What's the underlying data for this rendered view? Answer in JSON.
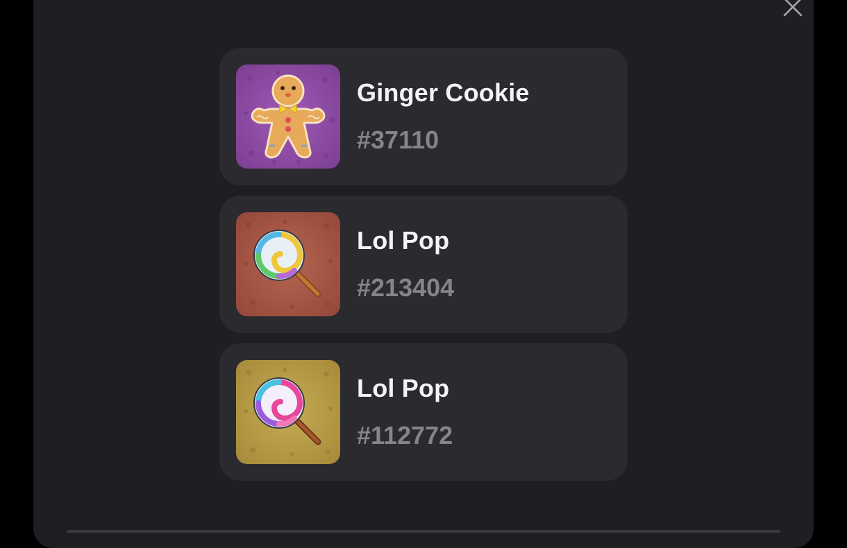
{
  "modal": {
    "close_icon": "close-icon",
    "items": [
      {
        "name": "Ginger Cookie",
        "id": "#37110",
        "icon": "gingerbread-cookie-icon",
        "bg_color": "#8e4aa5"
      },
      {
        "name": "Lol Pop",
        "id": "#213404",
        "icon": "lollipop-icon",
        "bg_color": "#a4533f"
      },
      {
        "name": "Lol Pop",
        "id": "#112772",
        "icon": "lollipop-icon",
        "bg_color": "#b69a45"
      }
    ]
  },
  "colors": {
    "page_bg": "#000000",
    "modal_bg": "#1f1e22",
    "card_bg": "#2b2a2f",
    "name_text": "#f4f4f6",
    "id_text": "#85848b"
  }
}
